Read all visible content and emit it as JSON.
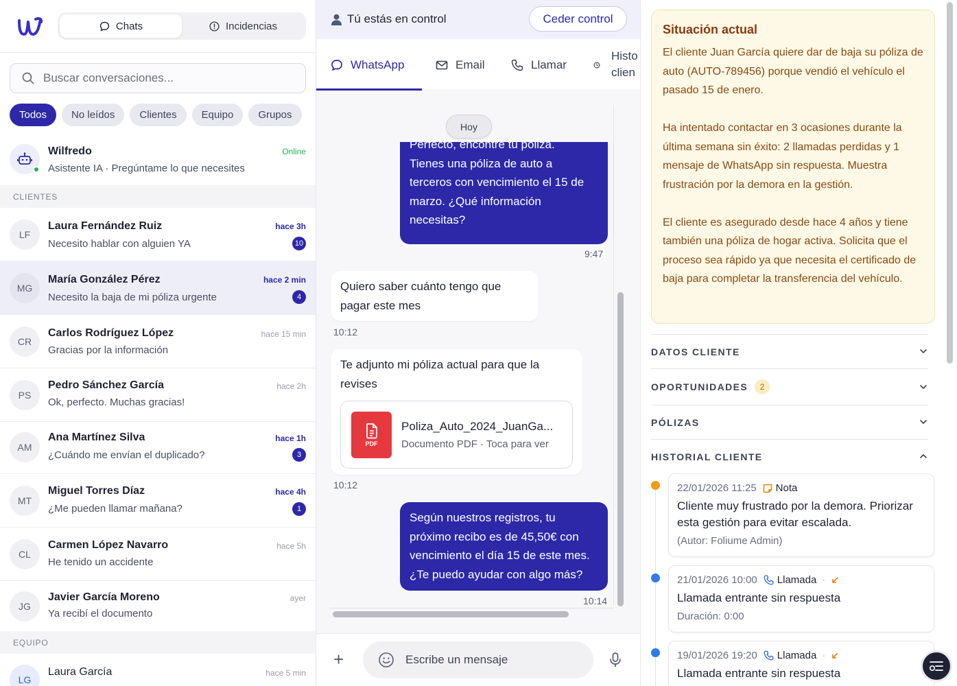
{
  "left": {
    "tabs": [
      {
        "label": "Chats"
      },
      {
        "label": "Incidencias"
      }
    ],
    "search_placeholder": "Buscar conversaciones...",
    "filters": [
      "Todos",
      "No leídos",
      "Clientes",
      "Equipo",
      "Grupos"
    ],
    "assistant": {
      "name": "Wilfredo",
      "status": "Online",
      "subtitle": "Asistente IA · Pregúntame lo que necesites"
    },
    "sections": {
      "clients": "CLIENTES",
      "team": "EQUIPO"
    },
    "clients": [
      {
        "initials": "LF",
        "name": "Laura Fernández Ruiz",
        "message": "Necesito hablar con alguien YA",
        "time": "hace 3h",
        "unread": "10"
      },
      {
        "initials": "MG",
        "name": "María González Pérez",
        "message": "Necesito la baja de mi póliza urgente",
        "time": "hace 2 min",
        "unread": "4"
      },
      {
        "initials": "CR",
        "name": "Carlos Rodríguez López",
        "message": "Gracias por la información",
        "time": "hace 15 min",
        "unread": ""
      },
      {
        "initials": "PS",
        "name": "Pedro Sánchez García",
        "message": "Ok, perfecto. Muchas gracias!",
        "time": "hace 2h",
        "unread": ""
      },
      {
        "initials": "AM",
        "name": "Ana Martínez Silva",
        "message": "¿Cuándo me envían el duplicado?",
        "time": "hace 1h",
        "unread": "3"
      },
      {
        "initials": "MT",
        "name": "Miguel Torres Díaz",
        "message": "¿Me pueden llamar mañana?",
        "time": "hace 4h",
        "unread": "1"
      },
      {
        "initials": "CL",
        "name": "Carmen López Navarro",
        "message": "He tenido un accidente",
        "time": "hace 5h",
        "unread": ""
      },
      {
        "initials": "JG",
        "name": "Javier García Moreno",
        "message": "Ya recibí el documento",
        "time": "ayer",
        "unread": ""
      }
    ],
    "team": [
      {
        "initials": "LG",
        "name": "Laura García",
        "time": "hace 5 min"
      }
    ]
  },
  "middle": {
    "control_text": "Tú estás en control",
    "cede_label": "Ceder control",
    "tabs": [
      "WhatsApp",
      "Email",
      "Llamar",
      "Histo",
      "clien"
    ],
    "today": "Hoy",
    "messages": [
      {
        "text_lines": [
          "Perfecto, encontré tu póliza.",
          "Tienes una póliza de auto a",
          "terceros con vencimiento el 15 de",
          "marzo. ¿Qué información",
          "necesitas?"
        ],
        "time": "9:47"
      },
      {
        "text_lines": [
          "Quiero saber cuánto tengo que",
          "pagar este mes"
        ],
        "time": "10:12"
      },
      {
        "text_lines": [
          "Te adjunto mi póliza actual para que la",
          "revises"
        ],
        "time": "10:12"
      },
      {
        "text_lines": [
          "Según nuestros registros, tu",
          "próximo recibo es de 45,50€ con",
          "vencimiento el día 15 de este mes.",
          "¿Te puedo ayudar con algo más?"
        ],
        "time": "10:14"
      }
    ],
    "attachment": {
      "name": "Poliza_Auto_2024_JuanGa...",
      "meta": "Documento PDF · Toca para ver",
      "icon_label": "PDF"
    },
    "composer_placeholder": "Escribe un mensaje"
  },
  "right": {
    "situation": {
      "title": "Situación actual",
      "paragraphs": [
        "El cliente Juan García quiere dar de baja su póliza de auto (AUTO-789456) porque vendió el vehículo el pasado 15 de enero.",
        "Ha intentado contactar en 3 ocasiones durante la última semana sin éxito: 2 llamadas perdidas y 1 mensaje de WhatsApp sin respuesta. Muestra frustración por la demora en la gestión.",
        "El cliente es asegurado desde hace 4 años y tiene también una póliza de hogar activa. Solicita que el proceso sea rápido ya que necesita el certificado de baja para completar la transferencia del vehículo."
      ]
    },
    "accordions": [
      {
        "label": "DATOS CLIENTE",
        "count": ""
      },
      {
        "label": "OPORTUNIDADES",
        "count": "2"
      },
      {
        "label": "PÓLIZAS",
        "count": ""
      },
      {
        "label": "HISTORIAL CLIENTE",
        "count": ""
      }
    ],
    "history": [
      {
        "date": "22/01/2026 11:25",
        "type": "Nota",
        "text": "Cliente muy frustrado por la demora. Priorizar esta gestión para evitar escalada.",
        "sub": "(Autor: Foliume Admin)",
        "dot_color": "#f29b12"
      },
      {
        "date": "21/01/2026 10:00",
        "type": "Llamada",
        "text": "Llamada entrante sin respuesta",
        "sub": "Duración: 0:00",
        "dot_color": "#2f7bea"
      },
      {
        "date": "19/01/2026 19:20",
        "type": "Llamada",
        "text": "Llamada entrante sin respuesta",
        "sub": "",
        "dot_color": "#2f7bea"
      }
    ]
  },
  "colors": {
    "brand": "#2c28a8",
    "online": "#22b455",
    "situation_bg": "#fef9e6",
    "pdf": "#e5393f"
  }
}
